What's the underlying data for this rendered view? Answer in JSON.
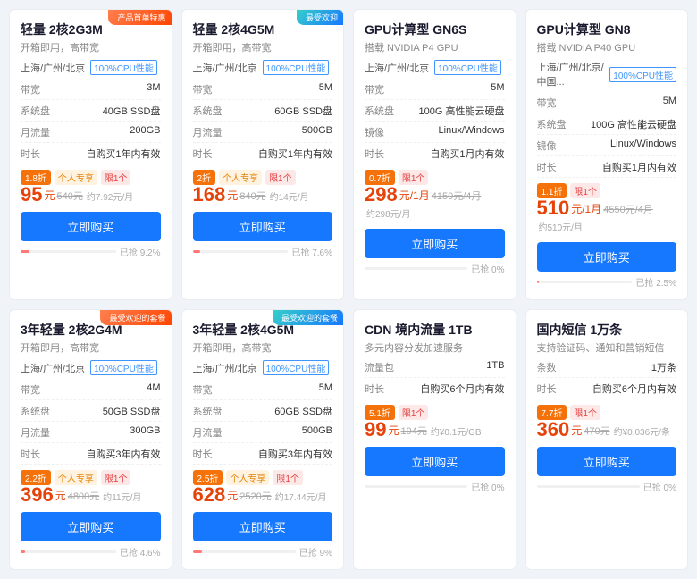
{
  "cards": [
    {
      "id": "card-1",
      "title": "轻量 2核2G3M",
      "subtitle": "开箱即用，高带宽",
      "cornerTag": "产品首单特惠",
      "cornerTagColor": "red",
      "location": "上海/广州/北京",
      "cpuBadge": "100%CPU性能",
      "specs": [
        {
          "label": "带宽",
          "value": "3M"
        },
        {
          "label": "系统盘",
          "value": "40GB SSD盘"
        },
        {
          "label": "月流量",
          "value": "200GB"
        },
        {
          "label": "时长",
          "value": "自购买1年内有效"
        }
      ],
      "discountBadge": "1.8折",
      "discountColor": "#f5720a",
      "tagPersonal": "个人专享",
      "tagLimit": "限1个",
      "priceMain": "95",
      "priceUnit": "元",
      "priceOriginal": "540元",
      "pricePerMonth": "约7.92元/月",
      "btnLabel": "立即购买",
      "soldText": "已抢 9.2%",
      "soldPct": 9.2
    },
    {
      "id": "card-2",
      "title": "轻量 2核4G5M",
      "subtitle": "开箱即用，高带宽",
      "cornerTag": "最受欢迎",
      "cornerTagColor": "blue",
      "location": "上海/广州/北京",
      "cpuBadge": "100%CPU性能",
      "specs": [
        {
          "label": "带宽",
          "value": "5M"
        },
        {
          "label": "系统盘",
          "value": "60GB SSD盘"
        },
        {
          "label": "月流量",
          "value": "500GB"
        },
        {
          "label": "时长",
          "value": "自购买1年内有效"
        }
      ],
      "discountBadge": "2折",
      "discountColor": "#f5720a",
      "tagPersonal": "个人专享",
      "tagLimit": "限1个",
      "priceMain": "168",
      "priceUnit": "元",
      "priceOriginal": "840元",
      "pricePerMonth": "约14元/月",
      "btnLabel": "立即购买",
      "soldText": "已抢 7.6%",
      "soldPct": 7.6
    },
    {
      "id": "card-3",
      "title": "GPU计算型 GN6S",
      "subtitle": "搭载 NVIDIA P4 GPU",
      "cornerTag": "",
      "cornerTagColor": "",
      "location": "上海/广州/北京",
      "cpuBadge": "100%CPU性能",
      "specs": [
        {
          "label": "带宽",
          "value": "5M"
        },
        {
          "label": "系统盘",
          "value": "100G 高性能云硬盘"
        },
        {
          "label": "镜像",
          "value": "Linux/Windows"
        },
        {
          "label": "时长",
          "value": "自购买1月内有效"
        }
      ],
      "discountBadge": "0.7折",
      "discountColor": "#f5720a",
      "tagPersonal": "",
      "tagLimit": "限1个",
      "priceMain": "298",
      "priceUnit": "元/1月",
      "priceOriginal": "4150元/4月",
      "pricePerMonth": "约298元/月",
      "btnLabel": "立即购买",
      "soldText": "已抢 0%",
      "soldPct": 0
    },
    {
      "id": "card-4",
      "title": "GPU计算型 GN8",
      "subtitle": "搭载 NVIDIA P40 GPU",
      "cornerTag": "",
      "cornerTagColor": "",
      "location": "上海/广州/北京/中国...",
      "cpuBadge": "100%CPU性能",
      "specs": [
        {
          "label": "带宽",
          "value": "5M"
        },
        {
          "label": "系统盘",
          "value": "100G 高性能云硬盘"
        },
        {
          "label": "镜像",
          "value": "Linux/Windows"
        },
        {
          "label": "时长",
          "value": "自购买1月内有效"
        }
      ],
      "discountBadge": "1.1折",
      "discountColor": "#f5720a",
      "tagPersonal": "",
      "tagLimit": "限1个",
      "priceMain": "510",
      "priceUnit": "元/1月",
      "priceOriginal": "4550元/4月",
      "pricePerMonth": "约510元/月",
      "btnLabel": "立即购买",
      "soldText": "已抢 2.5%",
      "soldPct": 2.5
    },
    {
      "id": "card-5",
      "title": "3年轻量 2核2G4M",
      "subtitle": "开箱即用，高带宽",
      "cornerTag": "最受欢迎的套餐",
      "cornerTagColor": "red",
      "location": "上海/广州/北京",
      "cpuBadge": "100%CPU性能",
      "specs": [
        {
          "label": "带宽",
          "value": "4M"
        },
        {
          "label": "系统盘",
          "value": "50GB SSD盘"
        },
        {
          "label": "月流量",
          "value": "300GB"
        },
        {
          "label": "时长",
          "value": "自购买3年内有效"
        }
      ],
      "discountBadge": "2.2折",
      "discountColor": "#f5720a",
      "tagPersonal": "个人专享",
      "tagLimit": "限1个",
      "priceMain": "396",
      "priceUnit": "元",
      "priceOriginal": "4800元",
      "pricePerMonth": "约11元/月",
      "btnLabel": "立即购买",
      "soldText": "已抢 4.6%",
      "soldPct": 4.6
    },
    {
      "id": "card-6",
      "title": "3年轻量 2核4G5M",
      "subtitle": "开箱即用，高带宽",
      "cornerTag": "最受欢迎的套餐",
      "cornerTagColor": "blue",
      "location": "上海/广州/北京",
      "cpuBadge": "100%CPU性能",
      "specs": [
        {
          "label": "带宽",
          "value": "5M"
        },
        {
          "label": "系统盘",
          "value": "60GB SSD盘"
        },
        {
          "label": "月流量",
          "value": "500GB"
        },
        {
          "label": "时长",
          "value": "自购买3年内有效"
        }
      ],
      "discountBadge": "2.5折",
      "discountColor": "#f5720a",
      "tagPersonal": "个人专享",
      "tagLimit": "限1个",
      "priceMain": "628",
      "priceUnit": "元",
      "priceOriginal": "2520元",
      "pricePerMonth": "约17.44元/月",
      "btnLabel": "立即购买",
      "soldText": "已抢 9%",
      "soldPct": 9
    },
    {
      "id": "card-7",
      "title": "CDN 境内流量 1TB",
      "subtitle": "多元内容分发加速服务",
      "cornerTag": "",
      "cornerTagColor": "",
      "location": "",
      "cpuBadge": "",
      "specs": [
        {
          "label": "流量包",
          "value": "1TB"
        },
        {
          "label": "时长",
          "value": "自购买6个月内有效"
        }
      ],
      "discountBadge": "5.1折",
      "discountColor": "#f5720a",
      "tagPersonal": "",
      "tagLimit": "限1个",
      "priceMain": "99",
      "priceUnit": "元",
      "priceOriginal": "194元",
      "pricePerMonth": "约¥0.1元/GB",
      "btnLabel": "立即购买",
      "soldText": "已抢 0%",
      "soldPct": 0
    },
    {
      "id": "card-8",
      "title": "国内短信 1万条",
      "subtitle": "支持验证码、通知和营销短信",
      "cornerTag": "",
      "cornerTagColor": "",
      "location": "",
      "cpuBadge": "",
      "specs": [
        {
          "label": "条数",
          "value": "1万条"
        },
        {
          "label": "时长",
          "value": "自购买6个月内有效"
        }
      ],
      "discountBadge": "7.7折",
      "discountColor": "#f5720a",
      "tagPersonal": "",
      "tagLimit": "限1个",
      "priceMain": "360",
      "priceUnit": "元",
      "priceOriginal": "470元",
      "pricePerMonth": "约¥0.036元/条",
      "btnLabel": "立即购买",
      "soldText": "已抢 0%",
      "soldPct": 0
    }
  ]
}
